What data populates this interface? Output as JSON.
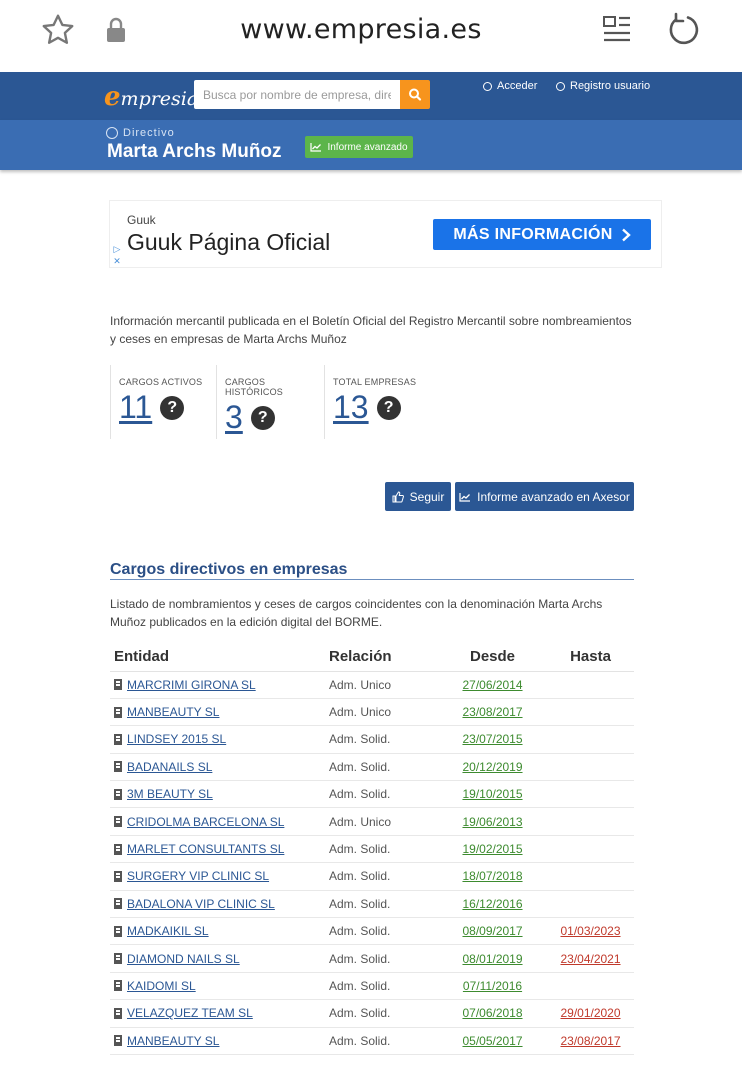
{
  "browser": {
    "url": "www.empresia.es"
  },
  "header": {
    "logo_initial": "e",
    "logo_rest": "mpresia",
    "search_placeholder": "Busca por nombre de empresa, directivo",
    "login_label": "Acceder",
    "register_label": "Registro usuario"
  },
  "subheader": {
    "section_label": "Directivo",
    "person_name": "Marta Archs Muñoz",
    "report_button": "Informe avanzado"
  },
  "ad": {
    "advertiser": "Guuk",
    "title": "Guuk Página Oficial",
    "cta": "MÁS INFORMACIÓN"
  },
  "intro": "Información mercantil publicada en el Boletín Oficial del Registro Mercantil sobre nombreamientos y ceses en empresas de Marta Archs Muñoz",
  "stats": [
    {
      "label": "CARGOS ACTIVOS",
      "value": "11"
    },
    {
      "label": "CARGOS HISTÓRICOS",
      "value": "3"
    },
    {
      "label": "TOTAL EMPRESAS",
      "value": "13"
    }
  ],
  "actions": {
    "follow": "Seguir",
    "report": "Informe avanzado en Axesor"
  },
  "section": {
    "title": "Cargos directivos en empresas",
    "description": "Listado de nombramientos y ceses de cargos coincidentes con la denominación Marta Archs Muñoz publicados en la edición digital del BORME."
  },
  "table": {
    "headers": [
      "Entidad",
      "Relación",
      "Desde",
      "Hasta"
    ],
    "rows": [
      {
        "entity": "MARCRIMI GIRONA SL",
        "relation": "Adm. Unico",
        "from": "27/06/2014",
        "to": ""
      },
      {
        "entity": "MANBEAUTY SL",
        "relation": "Adm. Unico",
        "from": "23/08/2017",
        "to": ""
      },
      {
        "entity": "LINDSEY 2015 SL",
        "relation": "Adm. Solid.",
        "from": "23/07/2015",
        "to": ""
      },
      {
        "entity": "BADANAILS SL",
        "relation": "Adm. Solid.",
        "from": "20/12/2019",
        "to": ""
      },
      {
        "entity": "3M BEAUTY SL",
        "relation": "Adm. Solid.",
        "from": "19/10/2015",
        "to": ""
      },
      {
        "entity": "CRIDOLMA BARCELONA SL",
        "relation": "Adm. Unico",
        "from": "19/06/2013",
        "to": ""
      },
      {
        "entity": "MARLET CONSULTANTS SL",
        "relation": "Adm. Solid.",
        "from": "19/02/2015",
        "to": ""
      },
      {
        "entity": "SURGERY VIP CLINIC SL",
        "relation": "Adm. Solid.",
        "from": "18/07/2018",
        "to": ""
      },
      {
        "entity": "BADALONA VIP CLINIC SL",
        "relation": "Adm. Solid.",
        "from": "16/12/2016",
        "to": ""
      },
      {
        "entity": "MADKAIKIL SL",
        "relation": "Adm. Solid.",
        "from": "08/09/2017",
        "to": "01/03/2023"
      },
      {
        "entity": "DIAMOND NAILS SL",
        "relation": "Adm. Solid.",
        "from": "08/01/2019",
        "to": "23/04/2021"
      },
      {
        "entity": "KAIDOMI SL",
        "relation": "Adm. Solid.",
        "from": "07/11/2016",
        "to": ""
      },
      {
        "entity": "VELAZQUEZ TEAM SL",
        "relation": "Adm. Solid.",
        "from": "07/06/2018",
        "to": "29/01/2020"
      },
      {
        "entity": "MANBEAUTY SL",
        "relation": "Adm. Solid.",
        "from": "05/05/2017",
        "to": "23/08/2017"
      }
    ]
  },
  "colors": {
    "brand_blue": "#2b5794",
    "sub_blue": "#3a6db3",
    "accent_orange": "#f7941d",
    "green": "#5cb54a",
    "date_green": "#3d8b2f",
    "date_red": "#c0392b"
  }
}
